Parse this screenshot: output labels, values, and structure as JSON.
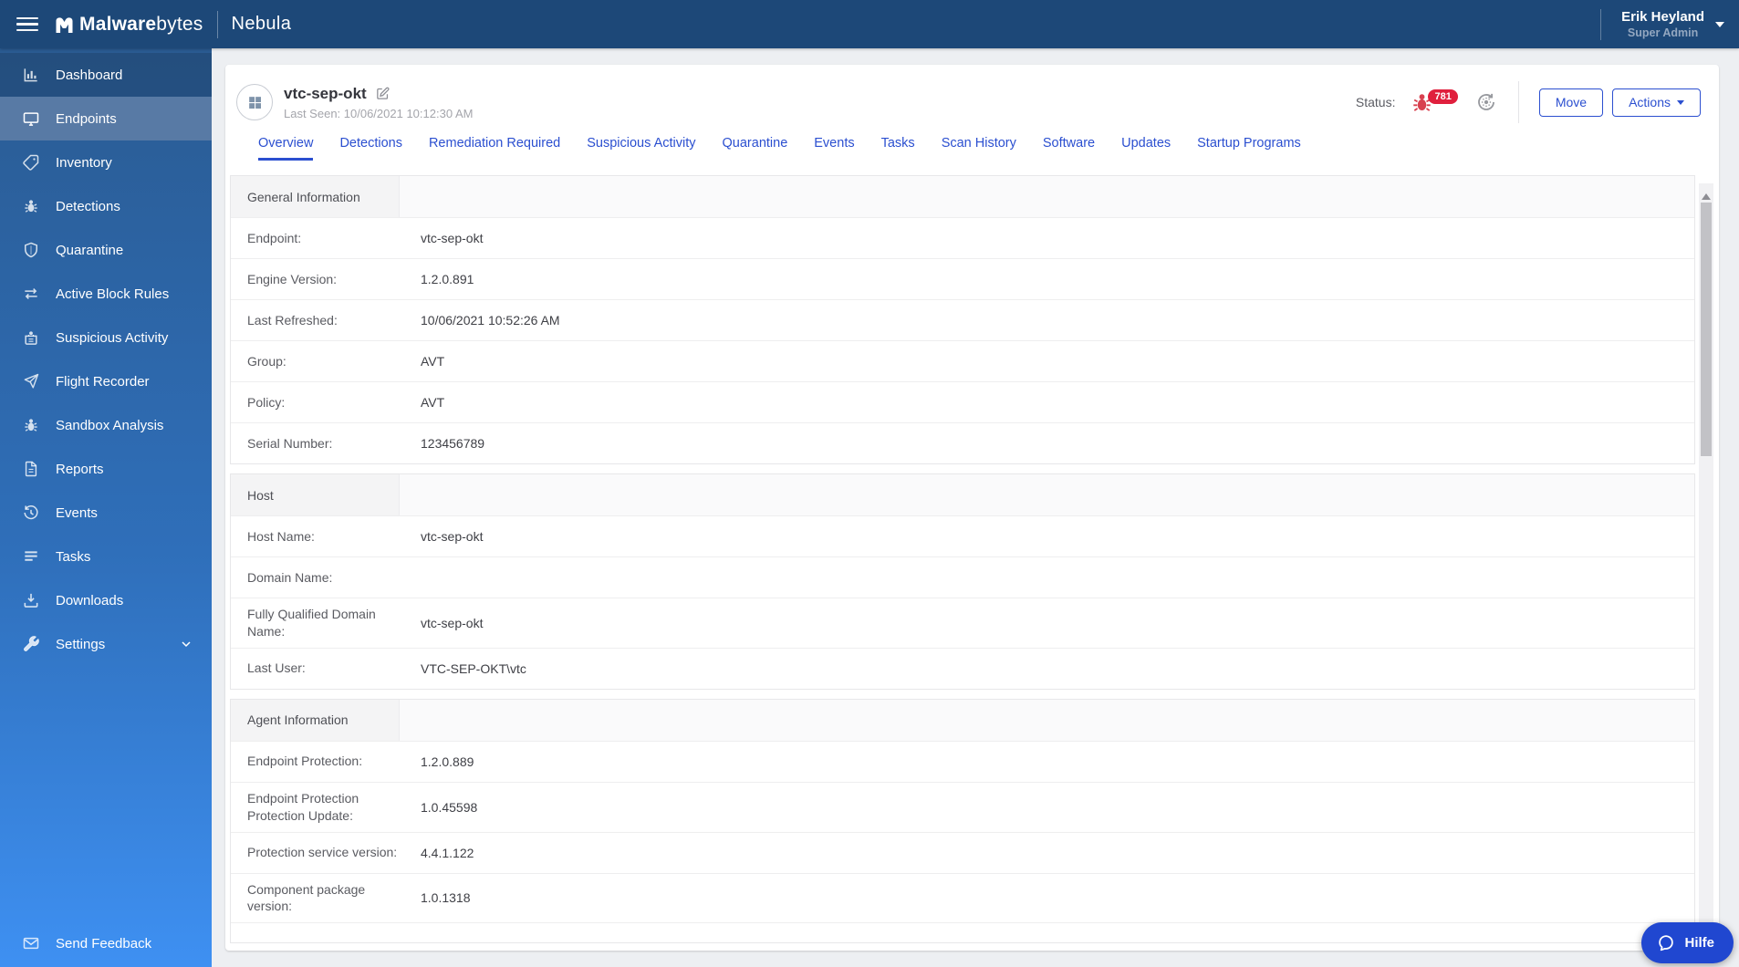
{
  "topbar": {
    "brand_strong": "Malware",
    "brand_rest": "bytes",
    "product": "Nebula",
    "user_name": "Erik Heyland",
    "user_role": "Super Admin"
  },
  "sidebar": {
    "items": [
      {
        "label": "Dashboard",
        "icon": "bar-chart-icon"
      },
      {
        "label": "Endpoints",
        "icon": "monitor-icon"
      },
      {
        "label": "Inventory",
        "icon": "tag-icon"
      },
      {
        "label": "Detections",
        "icon": "bug-icon"
      },
      {
        "label": "Quarantine",
        "icon": "shield-icon"
      },
      {
        "label": "Active Block Rules",
        "icon": "arrows-swap-icon"
      },
      {
        "label": "Suspicious Activity",
        "icon": "bug-box-icon"
      },
      {
        "label": "Flight Recorder",
        "icon": "paper-plane-icon"
      },
      {
        "label": "Sandbox Analysis",
        "icon": "bug-icon"
      },
      {
        "label": "Reports",
        "icon": "document-icon"
      },
      {
        "label": "Events",
        "icon": "history-icon"
      },
      {
        "label": "Tasks",
        "icon": "list-icon"
      },
      {
        "label": "Downloads",
        "icon": "download-icon"
      },
      {
        "label": "Settings",
        "icon": "wrench-icon"
      }
    ],
    "feedback_label": "Send Feedback"
  },
  "page": {
    "title": "vtc-sep-okt",
    "last_seen": "Last Seen: 10/06/2021 10:12:30 AM",
    "status_label": "Status:",
    "detections_badge": "781",
    "move_label": "Move",
    "actions_label": "Actions",
    "help_label": "Hilfe",
    "tabs": [
      "Overview",
      "Detections",
      "Remediation Required",
      "Suspicious Activity",
      "Quarantine",
      "Events",
      "Tasks",
      "Scan History",
      "Software",
      "Updates",
      "Startup Programs"
    ]
  },
  "sections": [
    {
      "title": "General Information",
      "rows": [
        {
          "label": "Endpoint:",
          "value": "vtc-sep-okt"
        },
        {
          "label": "Engine Version:",
          "value": "1.2.0.891"
        },
        {
          "label": "Last Refreshed:",
          "value": "10/06/2021 10:52:26 AM"
        },
        {
          "label": "Group:",
          "value": "AVT"
        },
        {
          "label": "Policy:",
          "value": "AVT"
        },
        {
          "label": "Serial Number:",
          "value": "123456789"
        }
      ]
    },
    {
      "title": "Host",
      "rows": [
        {
          "label": "Host Name:",
          "value": "vtc-sep-okt"
        },
        {
          "label": "Domain Name:",
          "value": ""
        },
        {
          "label": "Fully Qualified Domain Name:",
          "value": "vtc-sep-okt"
        },
        {
          "label": "Last User:",
          "value": "VTC-SEP-OKT\\vtc"
        }
      ]
    },
    {
      "title": "Agent Information",
      "rows": [
        {
          "label": "Endpoint Protection:",
          "value": "1.2.0.889"
        },
        {
          "label": "Endpoint Protection Protection Update:",
          "value": "1.0.45598"
        },
        {
          "label": "Protection service version:",
          "value": "4.4.1.122"
        },
        {
          "label": "Component package version:",
          "value": "1.0.1318"
        }
      ]
    }
  ],
  "colors": {
    "topbar_navy": "#1d4878",
    "sidebar_gradient_top": "#2a5b92",
    "sidebar_gradient_bottom": "#3e90f2",
    "active_nav_item": "#587aa5",
    "accent_blue": "#2b4fd0",
    "alert_red": "#e01f3d",
    "help_button_blue": "#2047d0"
  }
}
